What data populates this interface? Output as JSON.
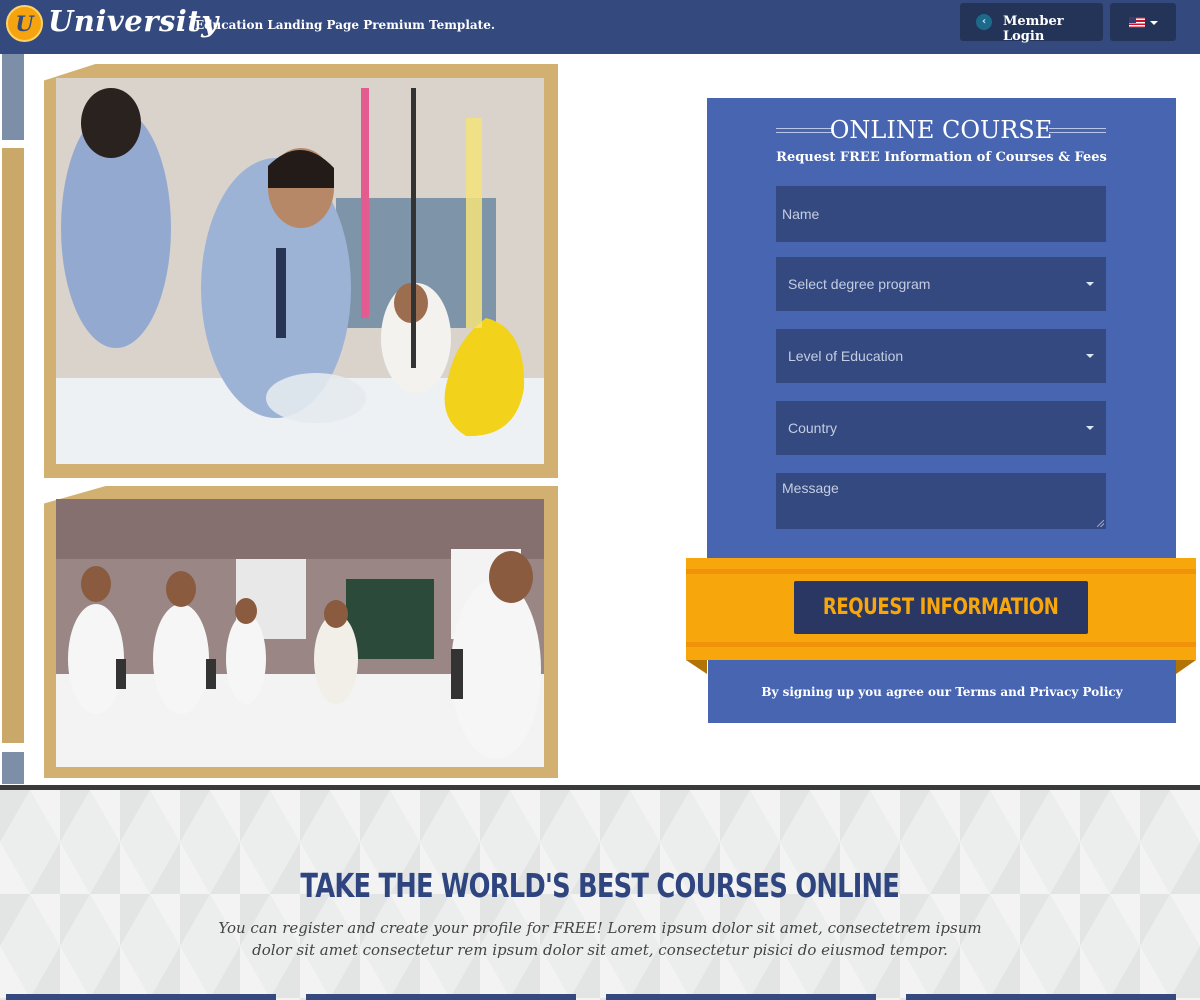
{
  "header": {
    "logo_letter": "U",
    "brand": "University",
    "tagline": "Education Landing Page Premium Template.",
    "member_login_label": "Member Login",
    "member_login_icon": "chevron-left-icon",
    "language_icon": "us-flag-icon"
  },
  "colors": {
    "header_bg": "#344a7f",
    "accent_orange": "#f7a60c",
    "form_bg": "#4765b0",
    "field_bg": "#33497f",
    "button_dark": "#2a3763",
    "title_blue": "#2f4580"
  },
  "form": {
    "title": "ONLINE COURSE",
    "subtitle": "Request FREE Information of Courses & Fees",
    "name_placeholder": "Name",
    "degree_placeholder": "Select degree program",
    "level_placeholder": "Level of Education",
    "country_placeholder": "Country",
    "message_placeholder": "Message",
    "submit_label": "Request Information",
    "agreement": "By signing up you agree our Terms and Privacy Policy"
  },
  "section": {
    "title": "TAKE THE WORLD'S BEST COURSES ONLINE",
    "description": "You can register and create your profile for FREE! Lorem ipsum dolor sit amet, consectetrem ipsum dolor sit amet consectetur rem ipsum dolor sit amet, consectetur pisici do eiusmod tempor."
  }
}
